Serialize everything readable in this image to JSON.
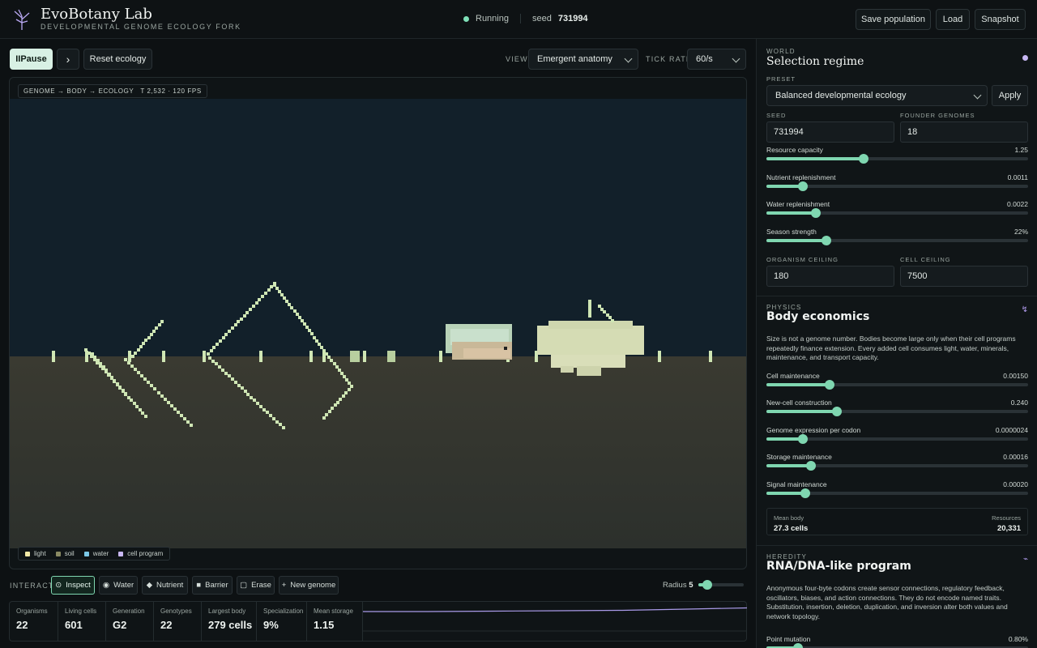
{
  "header": {
    "title": "EvoBotany Lab",
    "subtitle": "DEVELOPMENTAL GENOME ECOLOGY FORK",
    "status": "Running",
    "seed_label": "seed",
    "seed_value": "731994",
    "buttons": {
      "save": "Save population",
      "load": "Load",
      "snapshot": "Snapshot"
    }
  },
  "toolbar": {
    "pause": "IIPause",
    "step": "›",
    "reset": "Reset ecology",
    "view_label": "VIEW",
    "view_value": "Emergent anatomy",
    "tick_label": "TICK RATE",
    "tick_value": "60/s"
  },
  "canvas": {
    "badge_path": "GENOME → BODY → ECOLOGY",
    "badge_meta": "T 2,532 · 120 FPS",
    "legend": [
      {
        "label": "light",
        "color": "#f2e9a6"
      },
      {
        "label": "soil",
        "color": "#8a8a63"
      },
      {
        "label": "water",
        "color": "#7cc9e8"
      },
      {
        "label": "cell program",
        "color": "#c9b8f2"
      }
    ]
  },
  "interact": {
    "label": "INTERACT",
    "tools": [
      {
        "label": "Inspect",
        "glyph": "⊙",
        "active": true
      },
      {
        "label": "Water",
        "glyph": "◉",
        "active": false
      },
      {
        "label": "Nutrient",
        "glyph": "◆",
        "active": false
      },
      {
        "label": "Barrier",
        "glyph": "■",
        "active": false
      },
      {
        "label": "Erase",
        "glyph": "▢",
        "active": false
      },
      {
        "label": "New genome",
        "glyph": "+",
        "active": false
      }
    ],
    "radius_label": "Radius",
    "radius_value": "5",
    "radius_fraction": 0.2
  },
  "stats": [
    {
      "label": "Organisms",
      "value": "22"
    },
    {
      "label": "Living cells",
      "value": "601"
    },
    {
      "label": "Generation",
      "value": "G2"
    },
    {
      "label": "Genotypes",
      "value": "22"
    },
    {
      "label": "Largest body",
      "value": "279 cells"
    },
    {
      "label": "Specialization",
      "value": "9%"
    },
    {
      "label": "Mean storage",
      "value": "1.15"
    }
  ],
  "world": {
    "kicker": "WORLD",
    "title": "Selection regime",
    "preset_label": "PRESET",
    "preset_value": "Balanced developmental ecology",
    "apply": "Apply",
    "seed_label": "SEED",
    "seed_value": "731994",
    "founders_label": "FOUNDER GENOMES",
    "founders_value": "18",
    "sliders": [
      {
        "name": "Resource capacity",
        "value": "1.25",
        "fraction": 0.37
      },
      {
        "name": "Nutrient replenishment",
        "value": "0.0011",
        "fraction": 0.14
      },
      {
        "name": "Water replenishment",
        "value": "0.0022",
        "fraction": 0.19
      },
      {
        "name": "Season strength",
        "value": "22%",
        "fraction": 0.23
      }
    ],
    "organism_label": "ORGANISM CEILING",
    "organism_value": "180",
    "cell_label": "CELL CEILING",
    "cell_value": "7500"
  },
  "physics": {
    "kicker": "PHYSICS",
    "title": "Body economics",
    "description": "Size is not a genome number. Bodies become large only when their cell programs repeatedly finance extension. Every added cell consumes light, water, minerals, maintenance, and transport capacity.",
    "sliders": [
      {
        "name": "Cell maintenance",
        "value": "0.00150",
        "fraction": 0.24
      },
      {
        "name": "New-cell construction",
        "value": "0.240",
        "fraction": 0.27
      },
      {
        "name": "Genome expression per codon",
        "value": "0.0000024",
        "fraction": 0.14
      },
      {
        "name": "Storage maintenance",
        "value": "0.00016",
        "fraction": 0.17
      },
      {
        "name": "Signal maintenance",
        "value": "0.00020",
        "fraction": 0.15
      }
    ],
    "summary": {
      "left_label": "Mean body",
      "left_value": "27.3 cells",
      "right_label": "Resources",
      "right_value": "20,331"
    }
  },
  "heredity": {
    "kicker": "HEREDITY",
    "title": "RNA/DNA-like program",
    "description": "Anonymous four-byte codons create sensor connections, regulatory feedback, oscillators, biases, and action connections. They do not encode named traits. Substitution, insertion, deletion, duplication, and inversion alter both values and network topology.",
    "slider": {
      "name": "Point mutation",
      "value": "0.80%",
      "fraction": 0.12
    }
  }
}
